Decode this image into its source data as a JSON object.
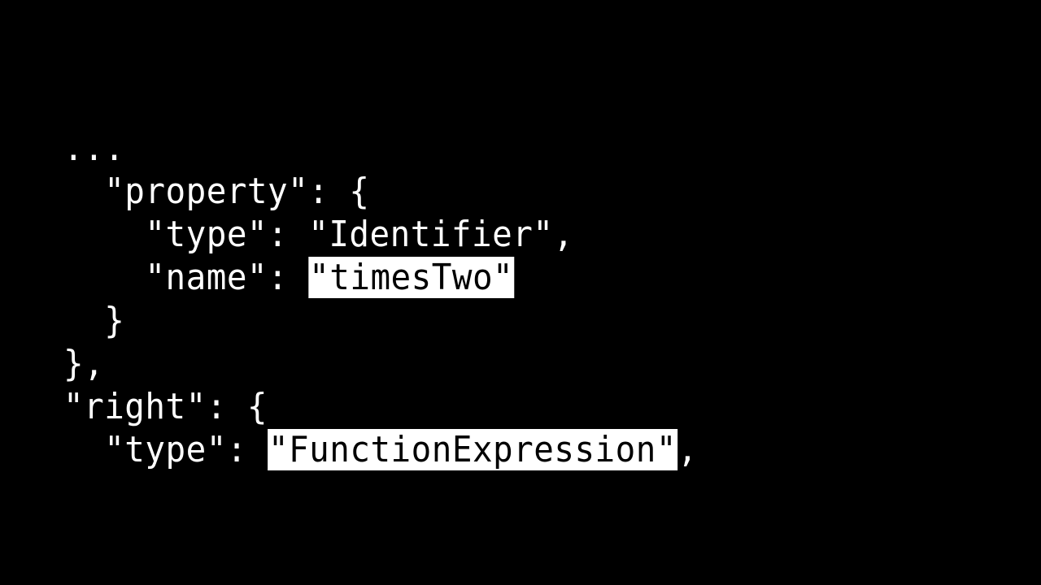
{
  "code_lines": [
    {
      "indent": "",
      "pre": "...",
      "highlight": "",
      "post": ""
    },
    {
      "indent": "  ",
      "pre": "\"property\": {",
      "highlight": "",
      "post": ""
    },
    {
      "indent": "    ",
      "pre": "\"type\": \"Identifier\",",
      "highlight": "",
      "post": ""
    },
    {
      "indent": "    ",
      "pre": "\"name\": ",
      "highlight": "\"timesTwo\"",
      "post": ""
    },
    {
      "indent": "  ",
      "pre": "}",
      "highlight": "",
      "post": ""
    },
    {
      "indent": "",
      "pre": "},",
      "highlight": "",
      "post": ""
    },
    {
      "indent": "",
      "pre": "\"right\": {",
      "highlight": "",
      "post": ""
    },
    {
      "indent": "  ",
      "pre": "\"type\": ",
      "highlight": "\"FunctionExpression\"",
      "post": ","
    }
  ],
  "colors": {
    "background": "#000000",
    "text": "#ffffff",
    "highlight_bg": "#ffffff",
    "highlight_text": "#000000"
  }
}
